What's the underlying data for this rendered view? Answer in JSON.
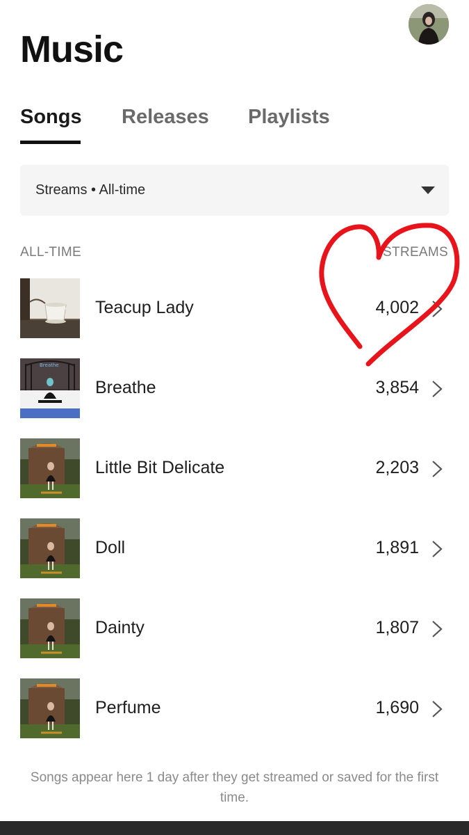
{
  "header": {
    "title": "Music",
    "avatar_icon": "profile-avatar"
  },
  "tabs": [
    {
      "label": "Songs",
      "active": true
    },
    {
      "label": "Releases",
      "active": false
    },
    {
      "label": "Playlists",
      "active": false
    }
  ],
  "filter": {
    "selected": "Streams • All-time",
    "icon": "caret-down-icon"
  },
  "columns": {
    "left": "ALL-TIME",
    "right": "STREAMS"
  },
  "songs": [
    {
      "title": "Teacup Lady",
      "streams": "4,002",
      "art": "teacup-artwork"
    },
    {
      "title": "Breathe",
      "streams": "3,854",
      "art": "breathe-artwork"
    },
    {
      "title": "Little Bit Delicate",
      "streams": "2,203",
      "art": "ep-artwork"
    },
    {
      "title": "Doll",
      "streams": "1,891",
      "art": "ep-artwork"
    },
    {
      "title": "Dainty",
      "streams": "1,807",
      "art": "ep-artwork"
    },
    {
      "title": "Perfume",
      "streams": "1,690",
      "art": "ep-artwork"
    }
  ],
  "footnote": "Songs appear here 1 day after they get streamed or saved for the first time.",
  "annotation": {
    "shape": "hand-drawn-heart",
    "color": "#e8141b"
  }
}
